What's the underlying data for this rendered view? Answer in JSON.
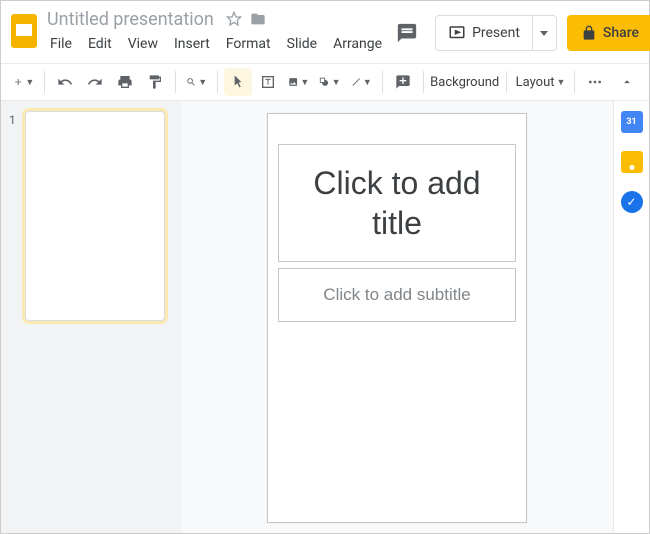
{
  "app": {
    "doc_title": "Untitled presentation"
  },
  "menubar": {
    "file": "File",
    "edit": "Edit",
    "view": "View",
    "insert": "Insert",
    "format": "Format",
    "slide": "Slide",
    "arrange": "Arrange"
  },
  "header": {
    "present": "Present",
    "share": "Share"
  },
  "toolbar": {
    "background": "Background",
    "layout": "Layout"
  },
  "filmstrip": {
    "slides": [
      {
        "num": "1"
      }
    ]
  },
  "slide": {
    "title_placeholder": "Click to add title",
    "subtitle_placeholder": "Click to add subtitle"
  },
  "sidepanel": {
    "calendar_day": "31"
  }
}
